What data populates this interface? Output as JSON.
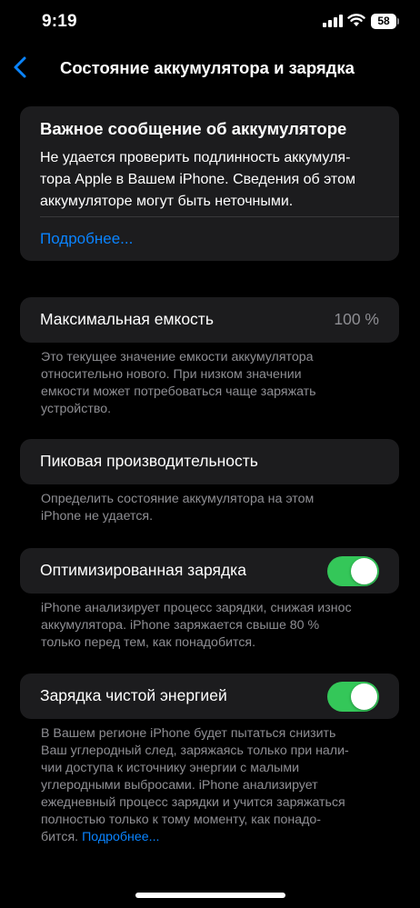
{
  "status_bar": {
    "time": "9:19",
    "battery": "58"
  },
  "nav": {
    "title": "Состояние аккумулятора и зарядка"
  },
  "alert": {
    "title": "Важное сообщение об аккумуляторе",
    "lines": [
      "Не удается проверить подлинность аккумуля-",
      "тора Apple в Вашем iPhone. Сведения об этом",
      "аккумуляторе могут быть неточными."
    ],
    "link": "Подробнее..."
  },
  "max_capacity": {
    "label": "Максимальная емкость",
    "value": "100 %",
    "footnote": [
      "Это текущее значение емкости аккумулятора",
      "относительно нового. При низком значении",
      "емкости может потребоваться чаще заряжать",
      "устройство."
    ]
  },
  "peak_performance": {
    "label": "Пиковая производительность",
    "footnote": [
      "Определить состояние аккумулятора на этом",
      "iPhone не удается."
    ]
  },
  "optimized_charging": {
    "label": "Оптимизированная зарядка",
    "enabled": true,
    "footnote": [
      "iPhone анализирует процесс зарядки, снижая износ",
      "аккумулятора. iPhone заряжается свыше 80 %",
      "только перед тем, как понадобится."
    ]
  },
  "clean_energy": {
    "label": "Зарядка чистой энергией",
    "enabled": true,
    "footnote": [
      "В Вашем регионе iPhone будет пытаться снизить",
      "Ваш углеродный след, заряжаясь только при нали-",
      "чии доступа к источнику энергии с малыми",
      "углеродными выбросами. iPhone анализирует",
      "ежедневный процесс зарядки и учится заряжаться",
      "полностью только к тому моменту, как понадо-"
    ],
    "footnote_last": "бится.",
    "footnote_link": "Подробнее..."
  },
  "colors": {
    "accent": "#0a84ff",
    "toggle_on": "#34c759",
    "card": "#1c1c1e",
    "secondary_text": "#8e8e93"
  }
}
